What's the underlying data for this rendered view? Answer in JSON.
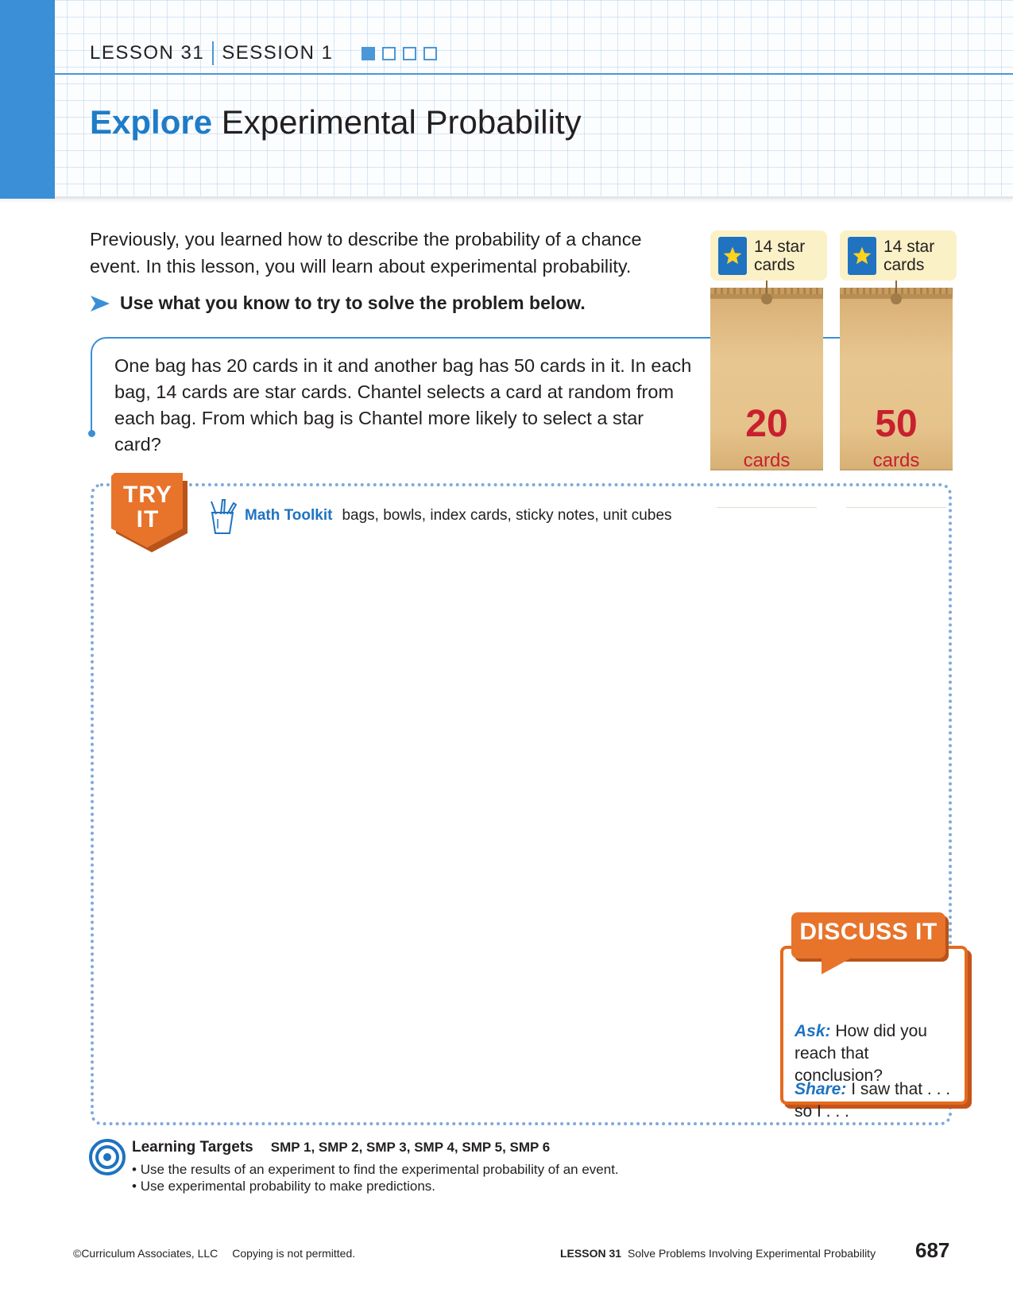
{
  "header": {
    "lesson": "LESSON 31",
    "session": "SESSION 1",
    "session_progress": {
      "current": 1,
      "total": 4
    },
    "title_highlight": "Explore",
    "title_rest": "Experimental Probability",
    "accent_color": "#3a8fd6"
  },
  "intro": {
    "paragraph": "Previously, you learned how to describe the probability of a chance event. In this lesson, you will learn about experimental probability.",
    "directive": "Use what you know to try to solve the problem below."
  },
  "problem": {
    "text": "One bag has 20 cards in it and another bag has 50 cards in it. In each bag, 14 cards are star cards. Chantel selects a card at random from each bag. From which bag is Chantel more likely to select a star card?"
  },
  "bags": [
    {
      "tag": "14 star cards",
      "number": "20",
      "label": "cards"
    },
    {
      "tag": "14 star cards",
      "number": "50",
      "label": "cards"
    }
  ],
  "try_it": {
    "badge_line1": "TRY",
    "badge_line2": "IT",
    "toolkit_label": "Math Toolkit",
    "toolkit_items": "bags, bowls, index cards, sticky notes, unit cubes"
  },
  "discuss_it": {
    "title": "DISCUSS IT",
    "ask_label": "Ask:",
    "ask_text": "How did you reach that conclusion?",
    "share_label": "Share:",
    "share_text": "I saw that . . . so I . . ."
  },
  "learning_targets": {
    "title": "Learning Targets",
    "smp": "SMP 1, SMP 2, SMP 3, SMP 4, SMP 5, SMP 6",
    "items": [
      "Use the results of an experiment to find the experimental probability of an event.",
      "Use experimental probability to make predictions."
    ]
  },
  "footer": {
    "copyright": "©Curriculum Associates, LLC",
    "notice": "Copying is not permitted.",
    "lesson": "LESSON 31",
    "lesson_title": "Solve Problems Involving Experimental Probability",
    "page": "687"
  }
}
